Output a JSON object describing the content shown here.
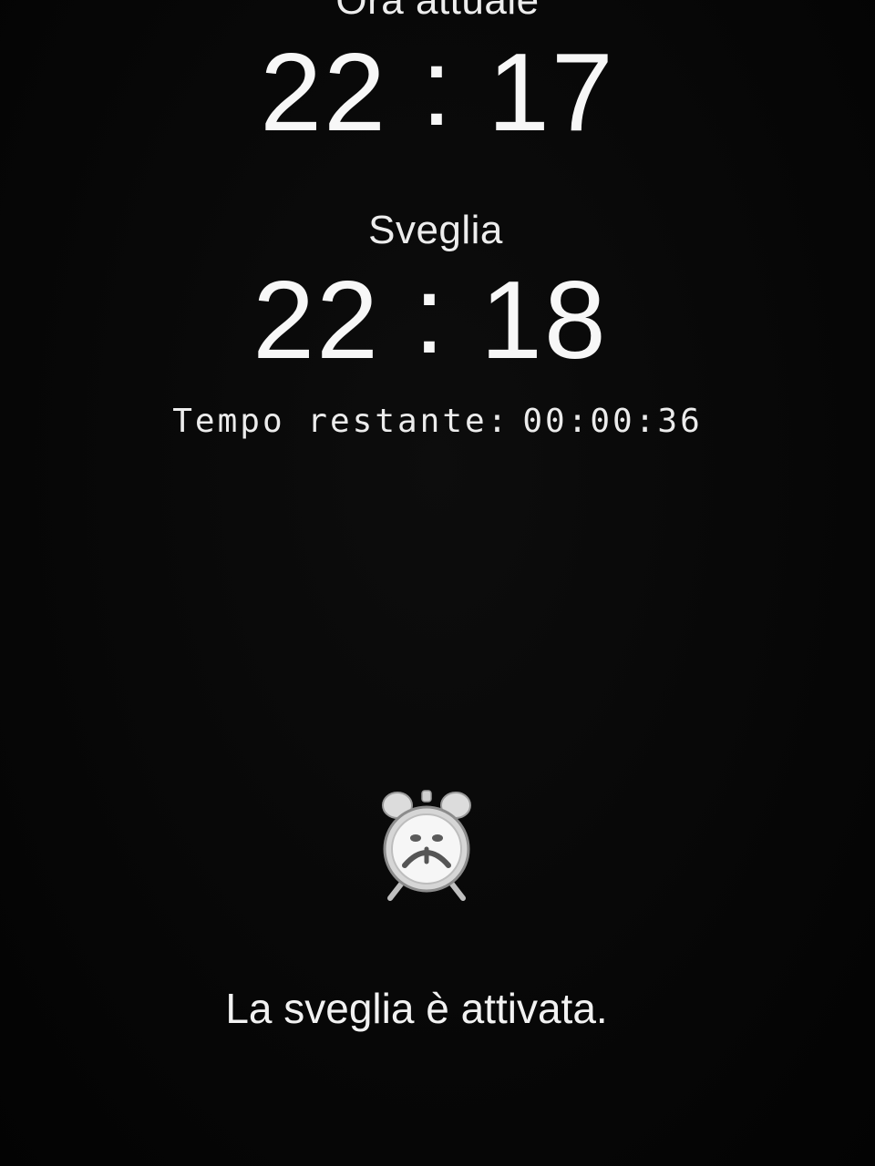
{
  "current": {
    "label": "Ora attuale",
    "hours": "22",
    "separator": ":",
    "minutes": "17"
  },
  "alarm": {
    "label": "Sveglia",
    "hours": "22",
    "separator": ":",
    "minutes": "18"
  },
  "remaining": {
    "label": "Tempo restante:",
    "value": "00:00:36"
  },
  "icon": {
    "name": "alarm-clock-icon"
  },
  "status": {
    "message": "La sveglia è attivata."
  },
  "colors": {
    "background": "#060606",
    "text": "#f4f4f4"
  }
}
